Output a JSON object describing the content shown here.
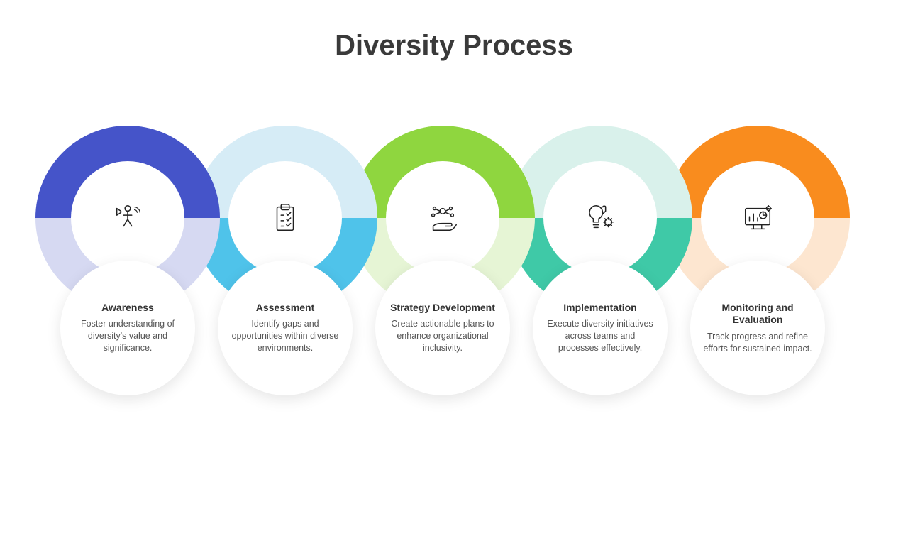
{
  "title": "Diversity Process",
  "steps": [
    {
      "title": "Awareness",
      "desc": "Foster understanding of diversity's value and significance.",
      "icon": "megaphone-person-icon",
      "top_color": "#4554c9",
      "bottom_color": "#d6d9f2"
    },
    {
      "title": "Assessment",
      "desc": "Identify gaps and opportunities within diverse environments.",
      "icon": "clipboard-check-icon",
      "top_color": "#d6ecf6",
      "bottom_color": "#4fc3ea"
    },
    {
      "title": "Strategy Development",
      "desc": "Create actionable plans to enhance organizational inclusivity.",
      "icon": "hand-network-icon",
      "top_color": "#8fd63f",
      "bottom_color": "#e6f5d5"
    },
    {
      "title": "Implementation",
      "desc": "Execute diversity initiatives across teams and processes effectively.",
      "icon": "idea-gears-icon",
      "top_color": "#d9f1eb",
      "bottom_color": "#3fc9a7"
    },
    {
      "title": "Monitoring and Evaluation",
      "desc": "Track progress and refine efforts for sustained impact.",
      "icon": "dashboard-chart-icon",
      "top_color": "#f98c1e",
      "bottom_color": "#fde6d0"
    }
  ]
}
